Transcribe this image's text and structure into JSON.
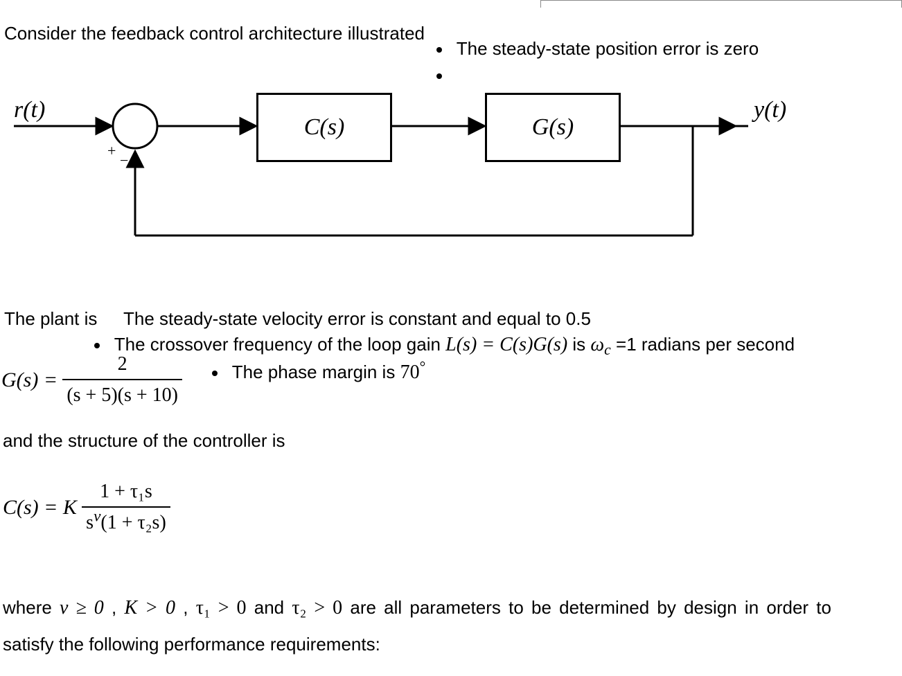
{
  "intro": "Consider the feedback control architecture illustrated",
  "bullets": {
    "b1": "The steady-state position error is zero",
    "b2_pre": "The plant is",
    "b2": "The steady-state velocity error is constant and equal to 0.5",
    "b3_pre": "The crossover frequency of the loop gain ",
    "b3_mid": " is ",
    "b3_post": "=1 radians per second",
    "b4_pre": "The phase margin is "
  },
  "diagram": {
    "input": "r(t)",
    "block1": "C(s)",
    "block2": "G(s)",
    "output": "y(t)",
    "plus": "+",
    "minus": "−"
  },
  "equations": {
    "G_lhs": "G(s) =",
    "G_num": "2",
    "G_den": "(s + 5)(s + 10)",
    "controller_intro": "and the structure of the controller is",
    "C_lhs": "C(s) = K",
    "C_num": "1 + τ₁s",
    "C_den_left": "s",
    "C_den_exp": "ν",
    "C_den_right": "(1 + τ₂s)",
    "L_expr": "L(s) = C(s)G(s)",
    "omega_c": "ω",
    "omega_sub": "c",
    "pm_value": "70",
    "deg": "°"
  },
  "closing": {
    "line1a": "where  ",
    "nu": "ν ≥ 0",
    "sep": ",  ",
    "K": "K > 0",
    "tau1": "τ₁ > 0",
    "and": "  and  ",
    "tau2": "τ₂ > 0",
    "line1b": "  are  all  parameters  to  be  determined  by  design  in  order  to",
    "line2": "satisfy the following performance requirements:"
  }
}
